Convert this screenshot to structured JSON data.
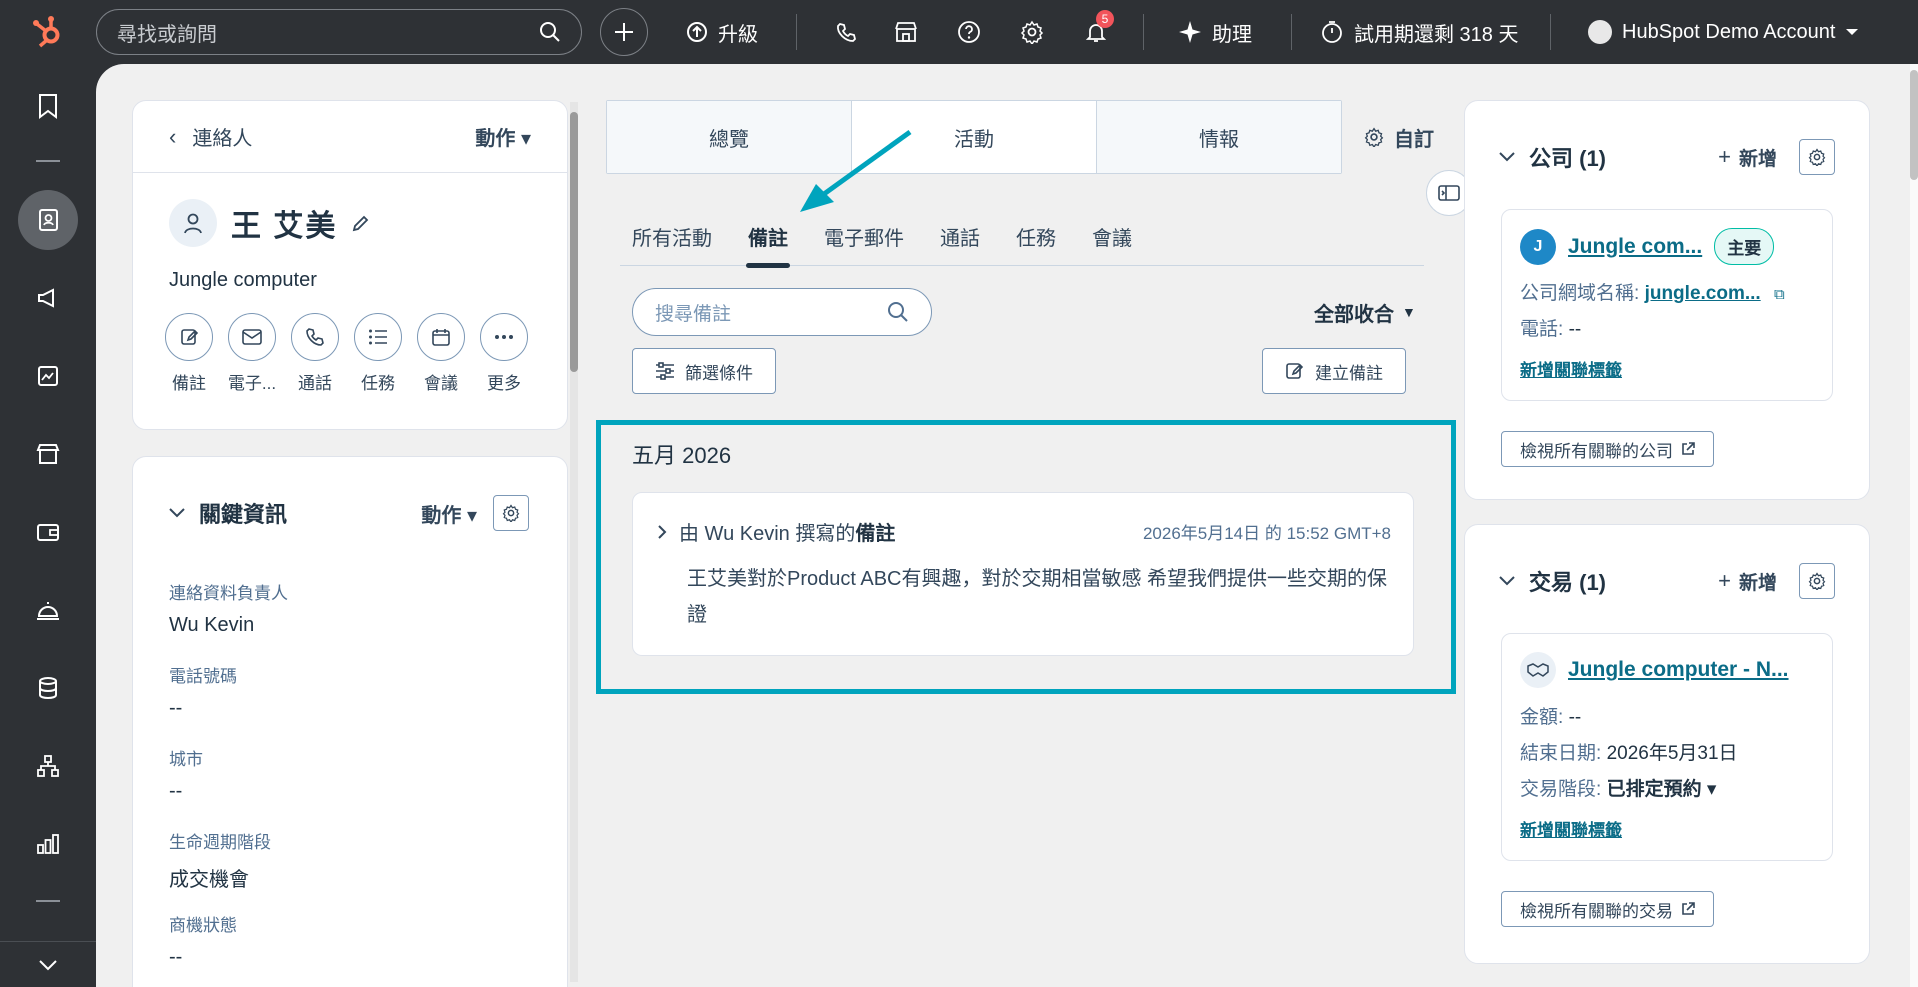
{
  "topbar": {
    "search_placeholder": "尋找或詢問",
    "upgrade_label": "升級",
    "assistant_label": "助理",
    "trial_label": "試用期還剩 318 天",
    "account_label": "HubSpot Demo Account",
    "notification_count": "5",
    "accent_color": "#ff7a59"
  },
  "left": {
    "back_label": "連絡人",
    "actions_label": "動作",
    "contact_name": "王 艾美",
    "company_name": "Jungle computer",
    "quick_actions": [
      "備註",
      "電子...",
      "通話",
      "任務",
      "會議",
      "更多"
    ],
    "key_info_title": "關鍵資訊",
    "key_info_actions": "動作",
    "properties": [
      {
        "label": "連絡資料負責人",
        "value": "Wu Kevin"
      },
      {
        "label": "電話號碼",
        "value": "--"
      },
      {
        "label": "城市",
        "value": "--"
      },
      {
        "label": "生命週期階段",
        "value": "成交機會"
      },
      {
        "label": "商機狀態",
        "value": "--"
      }
    ]
  },
  "middle": {
    "tabs": [
      "總覽",
      "活動",
      "情報"
    ],
    "active_tab": "活動",
    "customize_label": "自訂",
    "subtabs": [
      "所有活動",
      "備註",
      "電子郵件",
      "通話",
      "任務",
      "會議"
    ],
    "active_subtab": "備註",
    "note_search_placeholder": "搜尋備註",
    "collapse_all_label": "全部收合",
    "filter_label": "篩選條件",
    "create_note_label": "建立備註",
    "month_label": "五月 2026",
    "note": {
      "prefix": "由 Wu Kevin 撰寫的",
      "type": "備註",
      "timestamp": "2026年5月14日 的 15:52 GMT+8",
      "body": "王艾美對於Product ABC有興趣，對於交期相當敏感 希望我們提供一些交期的保證"
    },
    "highlight_color": "#00a4bd"
  },
  "right": {
    "companies": {
      "title": "公司 (1)",
      "add_label": "新增",
      "name": "Jungle com...",
      "primary_badge": "主要",
      "domain_label": "公司網域名稱: ",
      "domain_value": "jungle.com...",
      "phone_label": "電話: ",
      "phone_value": "--",
      "add_tag_label": "新增關聯標籤",
      "view_all_label": "檢視所有關聯的公司"
    },
    "deals": {
      "title": "交易 (1)",
      "add_label": "新增",
      "name": "Jungle computer - N...",
      "amount_label": "金額: ",
      "amount_value": "--",
      "close_date_label": "結束日期: ",
      "close_date_value": "2026年5月31日",
      "stage_label": "交易階段: ",
      "stage_value": "已排定預約",
      "add_tag_label": "新增關聯標籤",
      "view_all_label": "檢視所有關聯的交易"
    }
  }
}
